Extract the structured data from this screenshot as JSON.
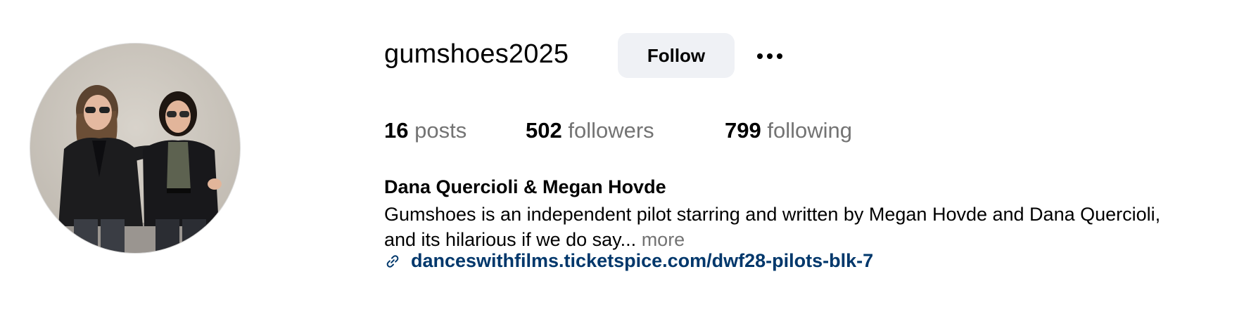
{
  "profile": {
    "username": "gumshoes2025",
    "follow_label": "Follow",
    "more_options_icon": "more-horizontal-icon",
    "avatar_alt": "gumshoes2025's profile picture",
    "stats": {
      "posts": {
        "count": "16",
        "label": "posts"
      },
      "followers": {
        "count": "502",
        "label": "followers"
      },
      "following": {
        "count": "799",
        "label": "following"
      }
    },
    "full_name": "Dana Quercioli & Megan Hovde",
    "bio_line1": "Gumshoes is an independent pilot starring and written by Megan Hovde and Dana Quercioli,",
    "bio_line2": "and its hilarious if we do say...",
    "bio_more": "more",
    "link_icon": "link-icon",
    "link": "danceswithfilms.ticketspice.com/dwf28-pilots-blk-7"
  },
  "colors": {
    "follow_bg": "#eff1f5",
    "secondary_text": "#737373",
    "link": "#00376b"
  }
}
